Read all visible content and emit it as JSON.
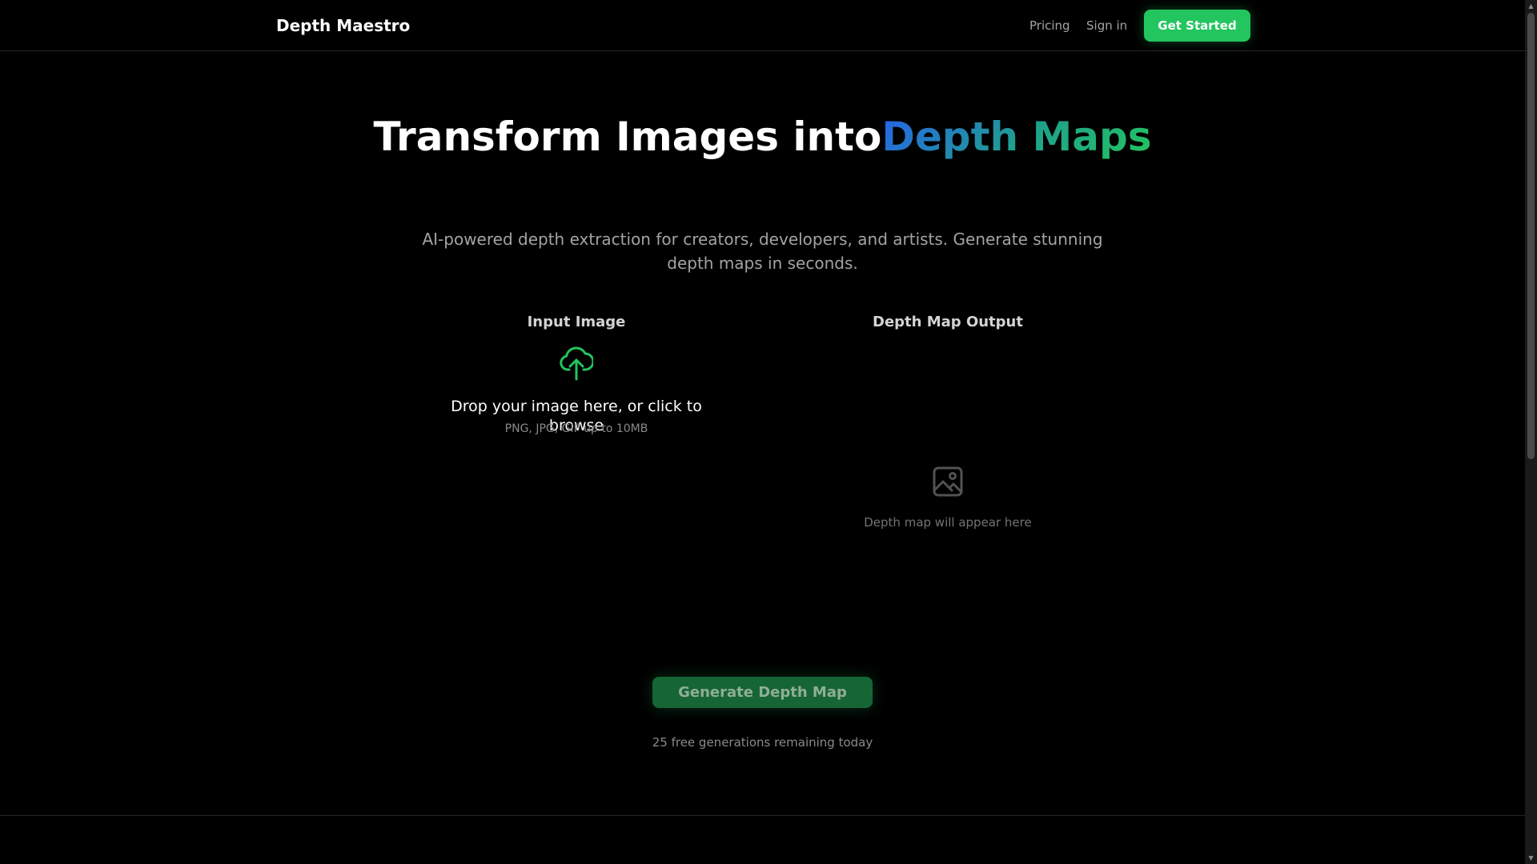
{
  "header": {
    "logo": "Depth Maestro",
    "nav": {
      "pricing": "Pricing",
      "sign_in": "Sign in",
      "get_started": "Get Started"
    }
  },
  "hero": {
    "title_plain": "Transform Images into",
    "title_highlight": "Depth Maps",
    "subtitle": "AI-powered depth extraction for creators, developers, and artists. Generate stunning depth maps in seconds."
  },
  "input_panel": {
    "title": "Input Image",
    "icon": "cloud-upload-icon",
    "drop_text": "Drop your image here, or click to browse",
    "file_types": "PNG, JPG, GIF up to 10MB"
  },
  "output_panel": {
    "title": "Depth Map Output",
    "icon": "image-icon",
    "placeholder": "Depth map will appear here"
  },
  "generate": {
    "button_label": "Generate Depth Map",
    "remaining": "25 free generations remaining today"
  },
  "colors": {
    "background": "#000000",
    "accent": "#22c55e",
    "gradient_start": "#2563eb",
    "gradient_end": "#22c55e",
    "muted_text": "#a3a3a3"
  }
}
